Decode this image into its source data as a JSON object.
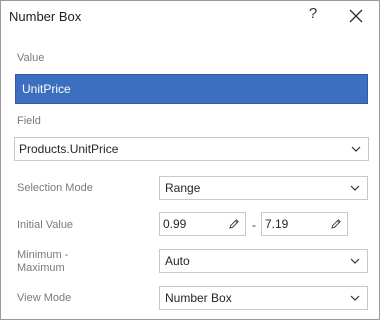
{
  "dialog": {
    "title": "Number Box",
    "help_label": "?",
    "close_icon": "close-icon"
  },
  "value_section": {
    "label": "Value",
    "value": "UnitPrice"
  },
  "field_section": {
    "label": "Field",
    "value": "Products.UnitPrice"
  },
  "settings": {
    "selection_mode": {
      "label": "Selection Mode",
      "value": "Range"
    },
    "initial_value": {
      "label": "Initial Value",
      "from": "0.99",
      "separator": "-",
      "to": "7.19"
    },
    "min_max": {
      "label": "Minimum -\nMaximum",
      "value": "Auto"
    },
    "view_mode": {
      "label": "View Mode",
      "value": "Number Box"
    }
  },
  "colors": {
    "selected_bg": "#3c6fbf",
    "border": "#c9c9c9"
  }
}
